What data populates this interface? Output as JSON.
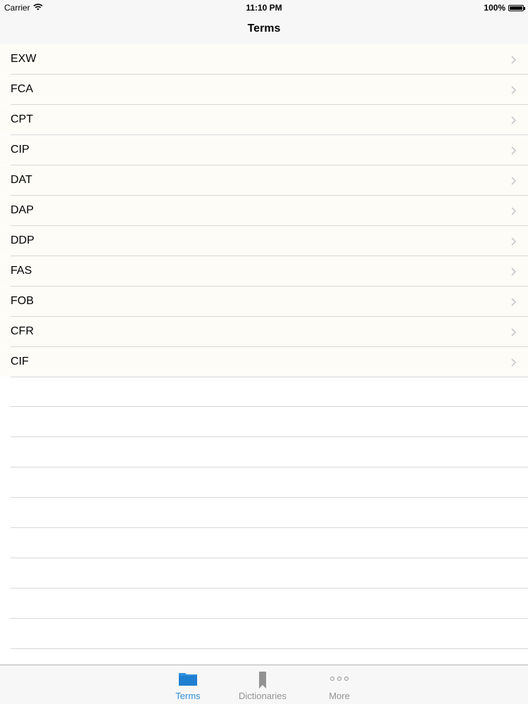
{
  "status_bar": {
    "carrier": "Carrier",
    "time": "11:10 PM",
    "battery_percent": "100%",
    "battery_level": 1.0,
    "wifi_icon": "wifi-icon"
  },
  "nav": {
    "title": "Terms"
  },
  "terms": [
    {
      "label": "EXW"
    },
    {
      "label": "FCA"
    },
    {
      "label": "CPT"
    },
    {
      "label": "CIP"
    },
    {
      "label": "DAT"
    },
    {
      "label": "DAP"
    },
    {
      "label": "DDP"
    },
    {
      "label": "FAS"
    },
    {
      "label": "FOB"
    },
    {
      "label": "CFR"
    },
    {
      "label": "CIF"
    }
  ],
  "tabs": [
    {
      "label": "Terms",
      "icon": "folder-icon",
      "active": true
    },
    {
      "label": "Dictionaries",
      "icon": "bookmark-icon",
      "active": false
    },
    {
      "label": "More",
      "icon": "more-icon",
      "active": false
    }
  ],
  "colors": {
    "accent": "#2f8fdc",
    "inactive": "#929292",
    "bar_background": "#f7f7f7",
    "row_background": "#fdfcf7",
    "separator": "#d8d8d8"
  }
}
